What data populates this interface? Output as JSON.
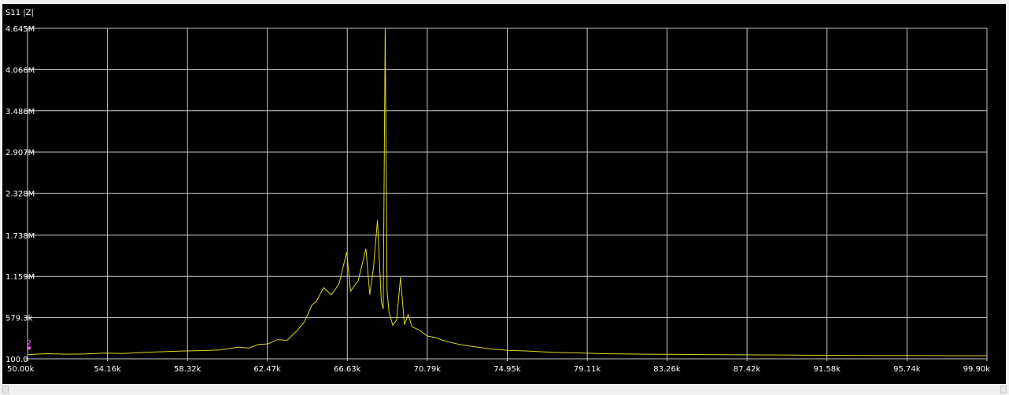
{
  "window": {
    "trace_title": "S11 |Z|"
  },
  "colors": {
    "background": "#000000",
    "grid": "#c8c8c8",
    "trace": "#d8d820",
    "labels": "#ffffff",
    "marker": "#ff55ff"
  },
  "chart_data": {
    "type": "line",
    "title": "",
    "ylabel": "",
    "xlabel": "",
    "x_unit": "Hz",
    "y_unit": "Ohm",
    "xlim": [
      50000,
      99900
    ],
    "ylim": [
      100,
      4645000
    ],
    "grid": true,
    "legend": "none",
    "x_tick_values": [
      50000,
      54160,
      58320,
      62470,
      66630,
      70790,
      74950,
      79110,
      83260,
      87420,
      91580,
      95740,
      99900
    ],
    "x_tick_labels": [
      "50.00k",
      "54.16k",
      "58.32k",
      "62.47k",
      "66.63k",
      "70.79k",
      "74.95k",
      "79.11k",
      "83.26k",
      "87.42k",
      "91.58k",
      "95.74k",
      "99.90k"
    ],
    "y_tick_values": [
      100,
      579300,
      1159000,
      1738000,
      2328000,
      2907000,
      3486000,
      4066000,
      4645000
    ],
    "y_tick_labels": [
      "100.0",
      "579.3k",
      "1.159M",
      "1.738M",
      "2.328M",
      "2.907M",
      "3.486M",
      "4.066M",
      "4.645M"
    ],
    "markers": [
      {
        "label": "2",
        "x": 50000,
        "y": 150000
      }
    ],
    "series": [
      {
        "x": [
          50000,
          51000,
          52000,
          53000,
          54000,
          55000,
          56000,
          57000,
          58000,
          59000,
          60000,
          61000,
          61500,
          62000,
          62500,
          63000,
          63500,
          64000,
          64400,
          64800,
          65000,
          65400,
          65800,
          66200,
          66600,
          66800,
          67200,
          67600,
          67800,
          68000,
          68200,
          68400,
          68500,
          68600,
          68700,
          68800,
          69000,
          69200,
          69400,
          69600,
          69800,
          70000,
          70400,
          70800,
          71200,
          71600,
          72000,
          72500,
          73000,
          73500,
          74000,
          75000,
          76000,
          77000,
          78000,
          79000,
          80000,
          82000,
          84000,
          86000,
          88000,
          90000,
          92000,
          94000,
          96000,
          98000,
          99900
        ],
        "y": [
          60000,
          72000,
          65000,
          68000,
          80000,
          75000,
          90000,
          100000,
          110000,
          115000,
          125000,
          165000,
          150000,
          200000,
          210000,
          270000,
          260000,
          390000,
          520000,
          760000,
          800000,
          1000000,
          900000,
          1050000,
          1500000,
          950000,
          1100000,
          1550000,
          900000,
          1300000,
          1950000,
          800000,
          700000,
          4645000,
          950000,
          650000,
          470000,
          550000,
          1150000,
          480000,
          620000,
          450000,
          400000,
          320000,
          300000,
          260000,
          230000,
          200000,
          180000,
          160000,
          140000,
          120000,
          110000,
          95000,
          85000,
          80000,
          72000,
          65000,
          62000,
          58000,
          55000,
          52000,
          50000,
          48000,
          46000,
          44000,
          44000
        ]
      }
    ]
  }
}
